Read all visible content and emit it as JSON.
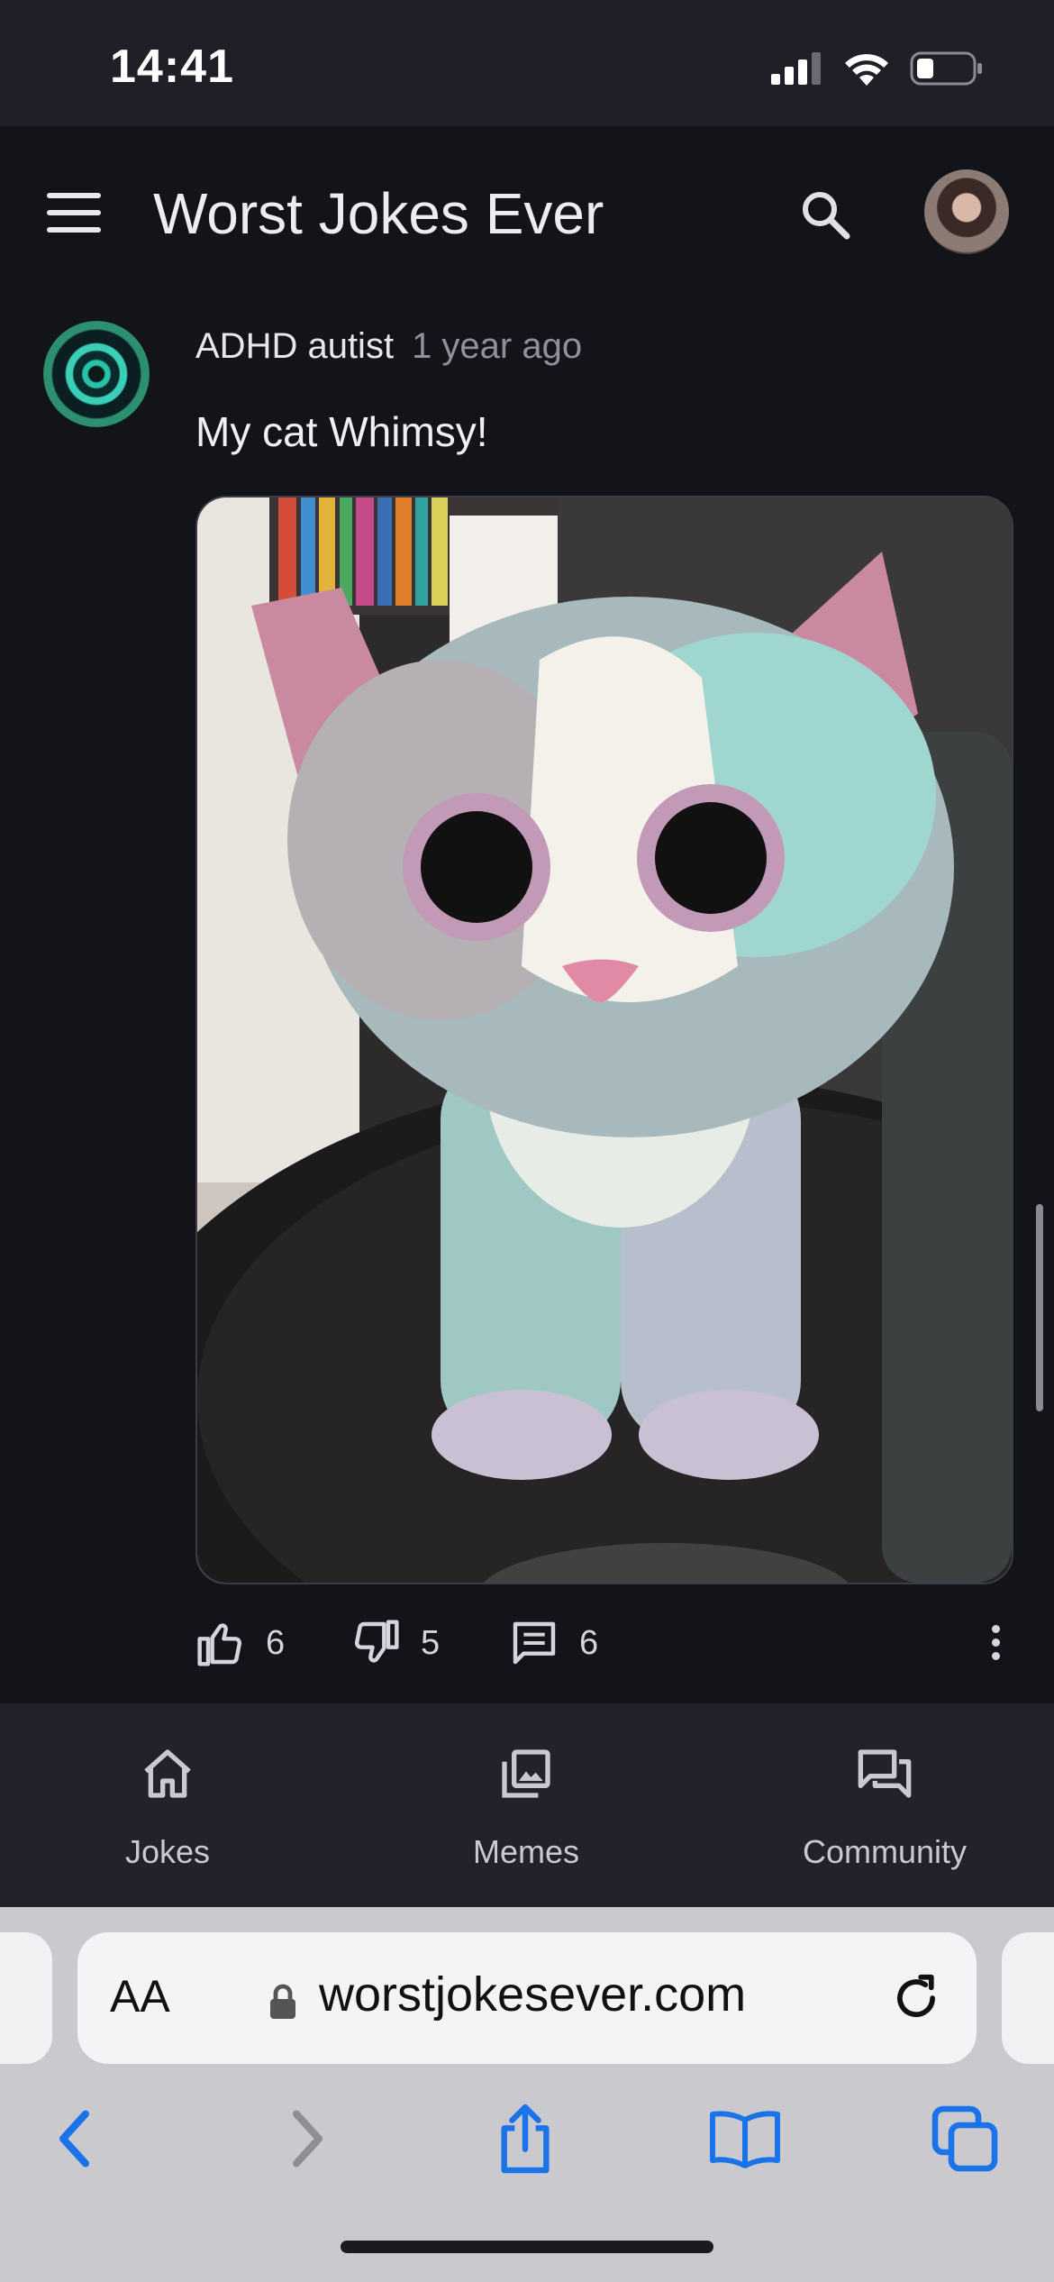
{
  "status_bar": {
    "time": "14:41"
  },
  "app": {
    "title": "Worst Jokes Ever"
  },
  "post": {
    "author": "ADHD autist",
    "time_ago": "1 year ago",
    "text": "My cat Whimsy!",
    "image_alt": "sequined plush cat toy",
    "likes": "6",
    "dislikes": "5",
    "comments": "6"
  },
  "bottom_nav": {
    "items": [
      {
        "label": "Jokes",
        "icon": "home-icon"
      },
      {
        "label": "Memes",
        "icon": "gallery-icon"
      },
      {
        "label": "Community",
        "icon": "chat-icon"
      }
    ]
  },
  "browser": {
    "text_size_label": "AA",
    "url": "worstjokesever.com"
  },
  "colors": {
    "background": "#13141a",
    "status_bar": "#1f2027",
    "nav_bar": "#22232a",
    "safari_accent": "#1a73e8"
  }
}
